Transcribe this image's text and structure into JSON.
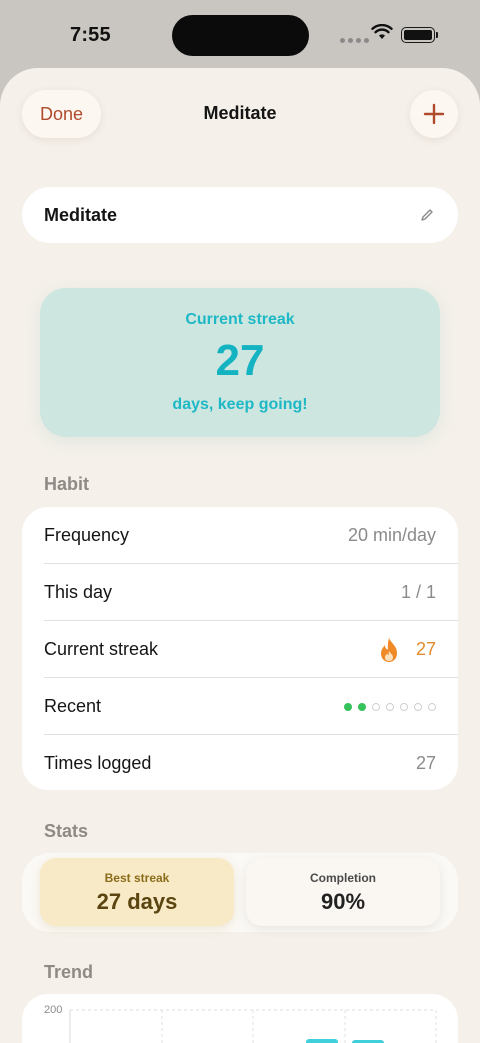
{
  "status_bar": {
    "time": "7:55"
  },
  "nav": {
    "done_label": "Done",
    "title": "Meditate"
  },
  "name_field": {
    "value": "Meditate"
  },
  "hero": {
    "label": "Current streak",
    "value": "27",
    "sub": "days, keep going!"
  },
  "habit": {
    "header": "Habit",
    "frequency": {
      "label": "Frequency",
      "value": "20 min/day"
    },
    "this_day": {
      "label": "This day",
      "value": "1 / 1"
    },
    "current_streak": {
      "label": "Current streak",
      "value": "27"
    },
    "recent": {
      "label": "Recent",
      "days": [
        true,
        true,
        false,
        false,
        false,
        false,
        false
      ]
    },
    "times_logged": {
      "label": "Times logged",
      "value": "27"
    }
  },
  "stats": {
    "header": "Stats",
    "best": {
      "label": "Best streak",
      "value": "27 days"
    },
    "completion": {
      "label": "Completion",
      "value": "90%"
    }
  },
  "trend": {
    "header": "Trend",
    "y_max_label": "200"
  },
  "colors": {
    "accent_done": "#b04a2c",
    "hero_teal": "#14b3c2",
    "streak_orange": "#e58a2b",
    "recent_green": "#34c25a",
    "trend_bar": "#3fd0dc"
  }
}
